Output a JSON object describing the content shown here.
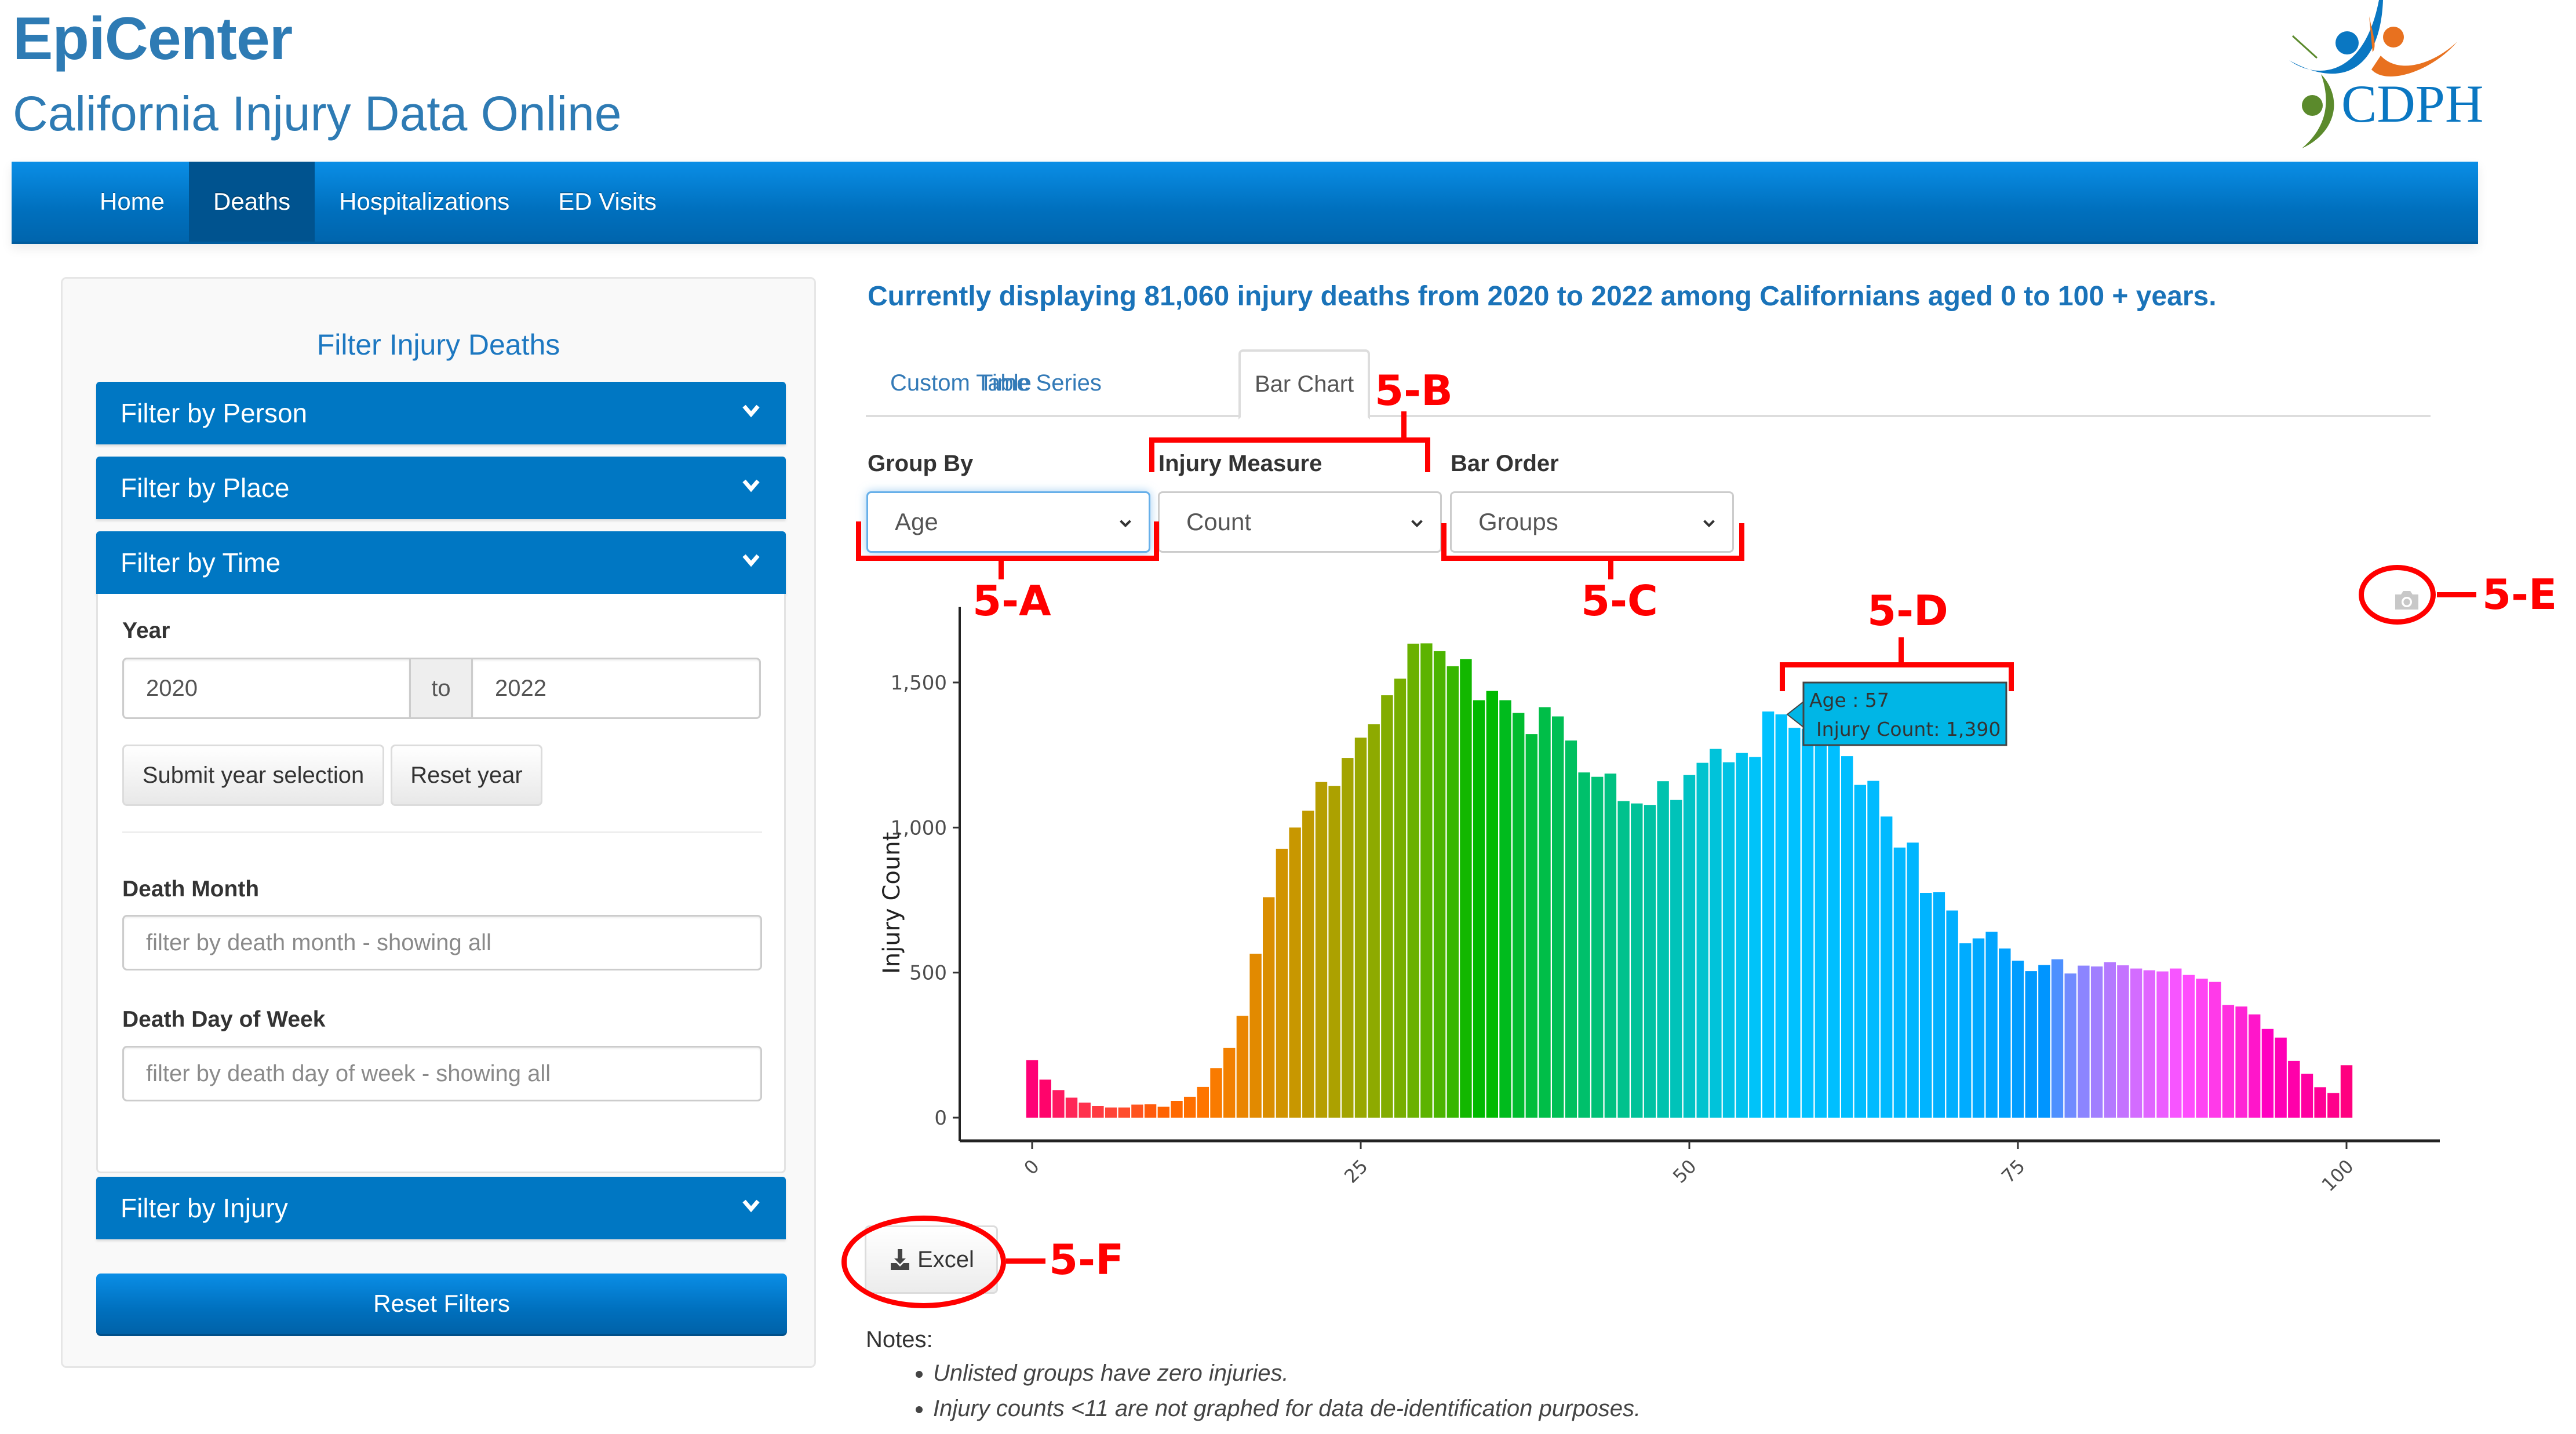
{
  "header": {
    "title": "EpiCenter",
    "subtitle": "California Injury Data Online",
    "logo_text": "CDPH",
    "logo_colors": {
      "blue": "#0a77c2",
      "orange": "#e8711f",
      "green": "#5b8a2c"
    }
  },
  "nav": {
    "items": [
      {
        "label": "Home",
        "active": false
      },
      {
        "label": "Deaths",
        "active": true
      },
      {
        "label": "Hospitalizations",
        "active": false
      },
      {
        "label": "ED Visits",
        "active": false
      }
    ]
  },
  "sidebar": {
    "title": "Filter Injury Deaths",
    "sections": [
      {
        "label": "Filter by Person",
        "icon": "chevron-down-icon"
      },
      {
        "label": "Filter by Place",
        "icon": "chevron-down-icon"
      },
      {
        "label": "Filter by Time",
        "icon": "chevron-down-icon"
      },
      {
        "label": "Filter by Injury",
        "icon": "chevron-down-icon"
      }
    ],
    "time": {
      "year_label": "Year",
      "year_from": "2020",
      "year_sep": "to",
      "year_to": "2022",
      "submit_label": "Submit year selection",
      "reset_label": "Reset year",
      "month_label": "Death Month",
      "month_placeholder": "filter by death month - showing all",
      "dow_label": "Death Day of Week",
      "dow_placeholder": "filter by death day of week - showing all"
    },
    "reset_filters_label": "Reset Filters"
  },
  "main": {
    "summary": "Currently displaying 81,060 injury deaths from 2020 to 2022 among Californians aged 0 to 100 + years.",
    "tabs": [
      {
        "label": "Custom Table",
        "active": false
      },
      {
        "label": "Time Series",
        "active": false
      },
      {
        "label": "Bar Chart",
        "active": true
      }
    ],
    "controls": {
      "group_by": {
        "label": "Group By",
        "value": "Age"
      },
      "injury_measure": {
        "label": "Injury Measure",
        "value": "Count"
      },
      "bar_order": {
        "label": "Bar Order",
        "value": "Groups"
      }
    },
    "camera_icon": "camera-icon",
    "excel_label": "Excel",
    "notes_title": "Notes:",
    "notes": [
      "Unlisted groups have zero injuries.",
      "Injury counts <11 are not graphed for data de-identification purposes."
    ]
  },
  "annotations": {
    "a": "5-A",
    "b": "5-B",
    "c": "5-C",
    "d": "5-D",
    "e": "5-E",
    "f": "5-F",
    "color": "#ff0000"
  },
  "chart_data": {
    "type": "bar",
    "title": "",
    "xlabel": "",
    "ylabel": "Injury Count",
    "x": [
      0,
      1,
      2,
      3,
      4,
      5,
      6,
      7,
      8,
      9,
      10,
      11,
      12,
      13,
      14,
      15,
      16,
      17,
      18,
      19,
      20,
      21,
      22,
      23,
      24,
      25,
      26,
      27,
      28,
      29,
      30,
      31,
      32,
      33,
      34,
      35,
      36,
      37,
      38,
      39,
      40,
      41,
      42,
      43,
      44,
      45,
      46,
      47,
      48,
      49,
      50,
      51,
      52,
      53,
      54,
      55,
      56,
      57,
      58,
      59,
      60,
      61,
      62,
      63,
      64,
      65,
      66,
      67,
      68,
      69,
      70,
      71,
      72,
      73,
      74,
      75,
      76,
      77,
      78,
      79,
      80,
      81,
      82,
      83,
      84,
      85,
      86,
      87,
      88,
      89,
      90,
      91,
      92,
      93,
      94,
      95,
      96,
      97,
      98,
      99,
      100
    ],
    "values": [
      198,
      131,
      95,
      69,
      52,
      40,
      35,
      35,
      45,
      46,
      38,
      58,
      72,
      106,
      171,
      240,
      351,
      565,
      760,
      927,
      1000,
      1058,
      1157,
      1143,
      1240,
      1310,
      1356,
      1456,
      1513,
      1634,
      1635,
      1608,
      1556,
      1581,
      1439,
      1471,
      1439,
      1395,
      1322,
      1415,
      1383,
      1300,
      1190,
      1175,
      1186,
      1091,
      1083,
      1078,
      1160,
      1095,
      1181,
      1223,
      1271,
      1225,
      1257,
      1243,
      1400,
      1390,
      1344,
      1340,
      1330,
      1300,
      1246,
      1147,
      1161,
      1038,
      931,
      948,
      775,
      777,
      714,
      601,
      618,
      641,
      583,
      541,
      505,
      526,
      546,
      497,
      524,
      521,
      536,
      525,
      514,
      508,
      504,
      514,
      492,
      479,
      468,
      388,
      383,
      356,
      306,
      276,
      196,
      151,
      105,
      85,
      181
    ],
    "xticks": [
      "0",
      "25",
      "50",
      "75",
      "100"
    ],
    "xtick_values": [
      0,
      25,
      50,
      75,
      100
    ],
    "yticks": [
      "0",
      "500",
      "1,000",
      "1,500"
    ],
    "ytick_values": [
      0,
      500,
      1000,
      1500
    ],
    "ylim": [
      -80,
      1720
    ],
    "xlim": [
      -2.5,
      102
    ],
    "grid": false,
    "legend": "none",
    "color_scale": "hue gradient (red → orange → olive → green → teal → blue → violet → pink) across groups",
    "tooltip": {
      "x_label": "Age",
      "x_value": "57",
      "y_label": "Injury Count",
      "y_value": "1,390",
      "bg": "#00b6e6"
    }
  }
}
